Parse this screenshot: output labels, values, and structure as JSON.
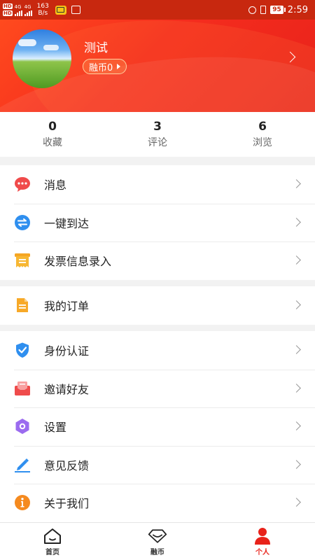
{
  "status_bar": {
    "hd1": "HD",
    "hd2": "HD",
    "net1": "4G",
    "net2": "4G",
    "speed_value": "163",
    "speed_unit": "B/s",
    "battery": "95",
    "time": "2:59"
  },
  "profile": {
    "username": "测试",
    "coin_label": "融币0"
  },
  "stats": [
    {
      "value": "0",
      "label": "收藏"
    },
    {
      "value": "3",
      "label": "评论"
    },
    {
      "value": "6",
      "label": "浏览"
    }
  ],
  "menu": {
    "messages": "消息",
    "one_click": "一键到达",
    "invoice": "发票信息录入",
    "orders": "我的订单",
    "identity": "身份认证",
    "invite": "邀请好友",
    "settings": "设置",
    "feedback": "意见反馈",
    "about": "关于我们"
  },
  "tabbar": {
    "home": "首页",
    "coin": "融币",
    "personal": "个人"
  },
  "colors": {
    "accent": "#e8221a",
    "header_gradient_start": "#ff4a1e",
    "background": "#f2f2f2"
  }
}
